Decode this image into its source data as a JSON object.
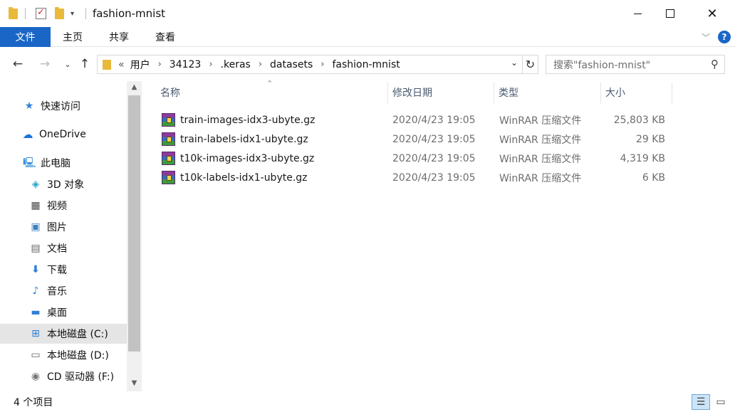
{
  "window": {
    "title": "fashion-mnist",
    "min_glyph": "",
    "max_glyph": "",
    "close_glyph": "✕"
  },
  "ribbon": {
    "file_tab": "文件",
    "tabs": [
      "主页",
      "共享",
      "查看"
    ]
  },
  "address": {
    "overflow": "«",
    "crumbs": [
      "用户",
      "34123",
      ".keras",
      "datasets",
      "fashion-mnist"
    ],
    "separator": "›"
  },
  "search": {
    "placeholder": "搜索\"fashion-mnist\""
  },
  "navpane": {
    "items": [
      {
        "label": "快速访问",
        "icon": "star-icon"
      },
      {
        "label": "OneDrive",
        "icon": "cloud-icon"
      },
      {
        "label": "此电脑",
        "icon": "computer-icon"
      },
      {
        "label": "3D 对象",
        "icon": "cube-icon"
      },
      {
        "label": "视频",
        "icon": "film-icon"
      },
      {
        "label": "图片",
        "icon": "picture-icon"
      },
      {
        "label": "文档",
        "icon": "document-icon"
      },
      {
        "label": "下载",
        "icon": "download-icon"
      },
      {
        "label": "音乐",
        "icon": "music-icon"
      },
      {
        "label": "桌面",
        "icon": "desktop-icon"
      },
      {
        "label": "本地磁盘 (C:)",
        "icon": "windows-drive-icon",
        "selected": true
      },
      {
        "label": "本地磁盘 (D:)",
        "icon": "drive-icon"
      },
      {
        "label": "CD 驱动器 (F:)",
        "icon": "cd-drive-icon"
      }
    ]
  },
  "filelist": {
    "columns": [
      "名称",
      "修改日期",
      "类型",
      "大小"
    ],
    "rows": [
      {
        "name": "train-images-idx3-ubyte.gz",
        "modified": "2020/4/23 19:05",
        "type": "WinRAR 压缩文件",
        "size": "25,803 KB"
      },
      {
        "name": "train-labels-idx1-ubyte.gz",
        "modified": "2020/4/23 19:05",
        "type": "WinRAR 压缩文件",
        "size": "29 KB"
      },
      {
        "name": "t10k-images-idx3-ubyte.gz",
        "modified": "2020/4/23 19:05",
        "type": "WinRAR 压缩文件",
        "size": "4,319 KB"
      },
      {
        "name": "t10k-labels-idx1-ubyte.gz",
        "modified": "2020/4/23 19:05",
        "type": "WinRAR 压缩文件",
        "size": "6 KB"
      }
    ]
  },
  "status": {
    "item_count": "4 个项目"
  },
  "colors": {
    "accent": "#1a66c7",
    "folder": "#e8b93b",
    "selected_bg": "#e5e5e5"
  }
}
